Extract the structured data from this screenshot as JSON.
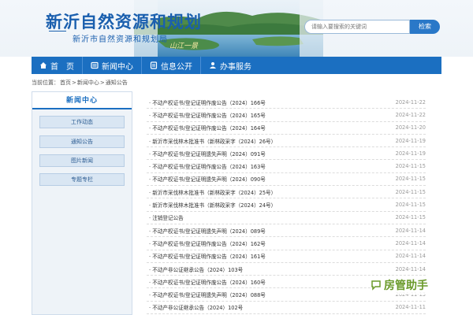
{
  "header": {
    "title": "新沂自然资源和规划",
    "subtitle": "新沂市自然资源和规划局",
    "scenery_caption": "山江一景",
    "search_placeholder": "请输入要搜索的关键词",
    "search_button": "检索"
  },
  "nav": {
    "items": [
      {
        "label": "首　页",
        "icon": "home-icon"
      },
      {
        "label": "新闻中心",
        "icon": "newspaper-icon"
      },
      {
        "label": "信息公开",
        "icon": "document-icon"
      },
      {
        "label": "办事服务",
        "icon": "service-icon"
      }
    ]
  },
  "breadcrumb": {
    "prefix": "当前位置：",
    "items": [
      "首页",
      "新闻中心",
      "通知公告"
    ],
    "separator": ">"
  },
  "sidebar": {
    "heading": "新闻中心",
    "items": [
      "工作动态",
      "通知公告",
      "图片新闻",
      "专题专栏"
    ]
  },
  "notices": [
    {
      "title": "· 不动产权证书/登记证明作废公告（2024）166号",
      "date": "2024-11-22"
    },
    {
      "title": "· 不动产权证书/登记证明作废公告（2024）165号",
      "date": "2024-11-22"
    },
    {
      "title": "· 不动产权证书/登记证明作废公告（2024）164号",
      "date": "2024-11-20"
    },
    {
      "title": "· 新沂市采伐林木批准书（新林政采字（2024）26号）",
      "date": "2024-11-19"
    },
    {
      "title": "· 不动产权证书/登记证明遗失声明（2024）091号",
      "date": "2024-11-19"
    },
    {
      "title": "· 不动产权证书/登记证明作废公告（2024）163号",
      "date": "2024-11-15"
    },
    {
      "title": "· 不动产权证书/登记证明遗失声明（2024）090号",
      "date": "2024-11-15"
    },
    {
      "title": "· 新沂市采伐林木批准书（新林政采字（2024）25号）",
      "date": "2024-11-15"
    },
    {
      "title": "· 新沂市采伐林木批准书（新林政采字（2024）24号）",
      "date": "2024-11-15"
    },
    {
      "title": "· 注销登记公告",
      "date": "2024-11-15"
    },
    {
      "title": "· 不动产权证书/登记证明遗失声明（2024）089号",
      "date": "2024-11-14"
    },
    {
      "title": "· 不动产权证书/登记证明作废公告（2024）162号",
      "date": "2024-11-14"
    },
    {
      "title": "· 不动产权证书/登记证明作废公告（2024）161号",
      "date": "2024-11-14"
    },
    {
      "title": "· 不动产非公证继承公告（2024）103号",
      "date": "2024-11-14"
    },
    {
      "title": "· 不动产权证书/登记证明作废公告（2024）160号",
      "date": "2024-11-13"
    },
    {
      "title": "· 不动产权证书/登记证明遗失声明（2024）088号",
      "date": "2024-11-13"
    },
    {
      "title": "· 不动产非公证继承公告（2024）102号",
      "date": "2024-11-11"
    }
  ],
  "watermark": {
    "text": "房管助手",
    "icon": "chat-bubble-icon"
  },
  "colors": {
    "primary": "#1b6fc1",
    "title": "#1a5fae",
    "badge": "#6a9a2a"
  }
}
